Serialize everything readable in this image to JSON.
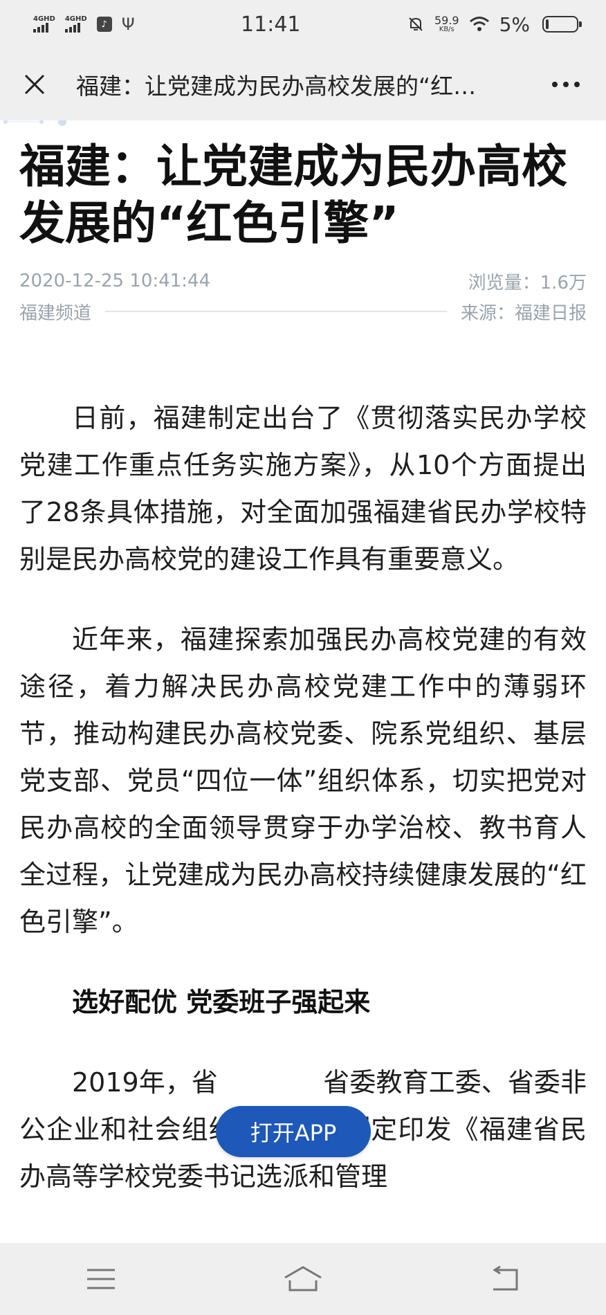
{
  "status_bar": {
    "sim1_label": "4GHD",
    "sim2_label": "4GHD",
    "time": "11:41",
    "net_speed": "59.9",
    "net_speed_unit": "KB/s",
    "battery": "5%"
  },
  "nav": {
    "title": "福建：让党建成为民办高校发展的“红…"
  },
  "article": {
    "headline": "福建：让党建成为民办高校发展的“红色引擎”",
    "datetime": "2020-12-25 10:41:44",
    "views": "浏览量：1.6万",
    "channel": "福建频道",
    "source": "来源：福建日报",
    "paragraphs": [
      "日前，福建制定出台了《贯彻落实民办学校党建工作重点任务实施方案》，从10个方面提出了28条具体措施，对全面加强福建省民办学校特别是民办高校党的建设工作具有重要意义。",
      "近年来，福建探索加强民办高校党建的有效途径，着力解决民办高校党建工作中的薄弱环节，推动构建民办高校党委、院系党组织、基层党支部、党员“四位一体”组织体系，切实把党对民办高校的全面领导贯穿于办学治校、教书育人全过程，让党建成为民办高校持续健康发展的“红色引擎”。"
    ],
    "subhead": "选好配优 党委班子强起来",
    "paragraph3": "2019年，省　　　　省委教育工委、省委非公企业和社会组织工委联合制定印发《福建省民办高等学校党委书记选派和管理"
  },
  "open_app_label": "打开APP",
  "colors": {
    "accent": "#1e58b8",
    "meta_text": "#9aa3ad",
    "bar_bg": "#efefef"
  },
  "icons": {
    "close": "close-icon",
    "more": "more-icon",
    "menu": "menu-icon",
    "home": "home-icon",
    "back": "back-icon"
  }
}
